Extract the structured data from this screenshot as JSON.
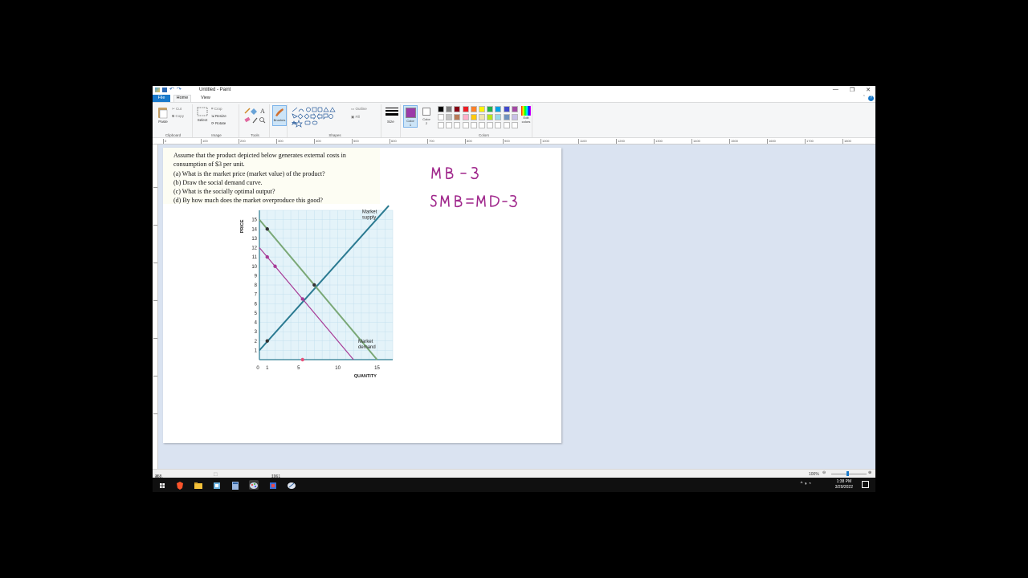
{
  "window": {
    "title": "Untitled - Paint",
    "controls": [
      "—",
      "❐",
      "✕"
    ]
  },
  "tabs": {
    "file": "File",
    "home": "Home",
    "view": "View"
  },
  "ribbon": {
    "clipboard": {
      "paste": "Paste",
      "cut": "Cut",
      "copy": "Copy",
      "label": "Clipboard"
    },
    "image": {
      "select": "Select",
      "crop": "Crop",
      "resize": "Resize",
      "rotate": "Rotate",
      "label": "Image"
    },
    "tools": {
      "label": "Tools"
    },
    "brushes": {
      "label": "Brushes"
    },
    "shapes": {
      "outline": "Outline",
      "fill": "Fill",
      "label": "Shapes"
    },
    "size": {
      "label": "Size"
    },
    "color1": {
      "label": "Color 1",
      "value": "#9b3aa8"
    },
    "color2": {
      "label": "Color 2",
      "value": "#ffffff"
    },
    "colors": {
      "label": "Colors",
      "edit": "Edit colors",
      "palette_row1": [
        "#000000",
        "#7f7f7f",
        "#880015",
        "#ed1c24",
        "#ff7f27",
        "#fff200",
        "#22b14c",
        "#00a2e8",
        "#3f48cc",
        "#a349a4"
      ],
      "palette_row2": [
        "#ffffff",
        "#c3c3c3",
        "#b97a57",
        "#ffaec9",
        "#ffc90e",
        "#efe4b0",
        "#b5e61d",
        "#99d9ea",
        "#7092be",
        "#c8bfe7"
      ]
    }
  },
  "ruler": {
    "top_marks": [
      "0",
      "100",
      "200",
      "300",
      "400",
      "500",
      "600",
      "700",
      "800",
      "900",
      "1000",
      "1100",
      "1200",
      "1300",
      "1400",
      "1500",
      "1600",
      "1700",
      "1800"
    ],
    "left_marks": [
      "100",
      "200",
      "300",
      "400",
      "500",
      "600",
      "700"
    ]
  },
  "problem": {
    "intro": "Assume that the product depicted below generates external costs in consumption of $3 per unit.",
    "a": "(a)  What is the market price (market value) of the product?",
    "b": "(b)  Draw the social demand curve.",
    "c": "(c)  What is the socially optimal output?",
    "d": "(d)  By how much does the market overproduce this good?"
  },
  "chart_data": {
    "type": "line",
    "ylabel": "PRICE",
    "xlabel": "QUANTITY",
    "xlim": [
      0,
      17
    ],
    "ylim": [
      0,
      16
    ],
    "x_ticks": [
      "0",
      "1",
      "5",
      "10",
      "15"
    ],
    "x_tick_values": [
      0,
      1,
      5,
      10,
      15
    ],
    "y_ticks": [
      1,
      2,
      3,
      4,
      5,
      6,
      7,
      8,
      9,
      10,
      11,
      12,
      13,
      14,
      15
    ],
    "series": [
      {
        "name": "Market supply",
        "color": "#2b7a91",
        "x": [
          0,
          16.5
        ],
        "y": [
          1,
          16.5
        ]
      },
      {
        "name": "Market demand",
        "color": "#7aa876",
        "x": [
          0,
          15
        ],
        "y": [
          15,
          0
        ]
      },
      {
        "name": "",
        "color": "#a73b96",
        "x": [
          0,
          12
        ],
        "y": [
          12,
          0
        ]
      }
    ],
    "points": [
      {
        "x": 1,
        "y": 14,
        "color": "#333333"
      },
      {
        "x": 1,
        "y": 2,
        "color": "#333333"
      },
      {
        "x": 7,
        "y": 8,
        "color": "#333333"
      },
      {
        "x": 1,
        "y": 11,
        "color": "#a73b96"
      },
      {
        "x": 2,
        "y": 10,
        "color": "#a73b96"
      },
      {
        "x": 5.5,
        "y": 6.5,
        "color": "#a73b96"
      },
      {
        "x": 5.5,
        "y": 0,
        "color": "#e8527a"
      }
    ],
    "annotations": [
      "Market supply",
      "Market demand"
    ]
  },
  "handwriting": {
    "line1": "MB-3",
    "line2": "SMB=MB-3",
    "color": "#a0288c"
  },
  "status": {
    "cursor": "358, 623px",
    "size": "1061 × 786px",
    "zoom": "100%"
  },
  "taskbar": {
    "time": "1:38 PM",
    "date": "3/29/2022"
  }
}
